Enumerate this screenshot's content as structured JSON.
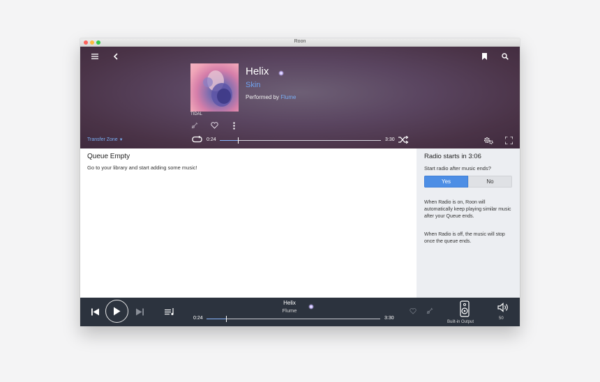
{
  "window": {
    "title": "Roon"
  },
  "now_playing": {
    "track_title": "Helix",
    "album": "Skin",
    "performed_by_prefix": "Performed by",
    "artist": "Flume",
    "source": "TIDAL",
    "elapsed": "0:24",
    "duration": "3:30",
    "progress_fraction": 0.114
  },
  "zone": {
    "transfer_label": "Transfer Zone"
  },
  "queue": {
    "title": "Queue Empty",
    "message": "Go to your library and start adding some music!"
  },
  "radio": {
    "title": "Radio starts in 3:06",
    "question": "Start radio after music ends?",
    "yes_label": "Yes",
    "no_label": "No",
    "selected": "Yes",
    "note_on": "When Radio is on, Roon will automatically keep playing similar music after your Queue ends.",
    "note_off": "When Radio is off, the music will stop once the queue ends."
  },
  "player_bar": {
    "title": "Helix",
    "artist": "Flume",
    "elapsed": "0:24",
    "duration": "3:30",
    "progress_fraction": 0.114,
    "output_label": "Built-in Output",
    "volume": "50"
  },
  "icons": {
    "menu": "hamburger-icon",
    "back": "chevron-left-icon",
    "bookmark": "bookmark-icon",
    "search": "search-icon",
    "settings": "gears-icon",
    "fullscreen": "fullscreen-icon",
    "repeat": "repeat-icon",
    "shuffle": "shuffle-icon",
    "heart": "heart-icon",
    "more": "more-vertical-icon",
    "focus": "focus-guitar-icon",
    "prev": "skip-previous-icon",
    "play": "play-icon",
    "next": "skip-next-icon",
    "queue": "queue-icon",
    "speaker": "speaker-icon",
    "volume": "volume-icon"
  },
  "colors": {
    "accent": "#4d8ee5",
    "link": "#7ab0f5",
    "player_bg": "#2c333e"
  }
}
